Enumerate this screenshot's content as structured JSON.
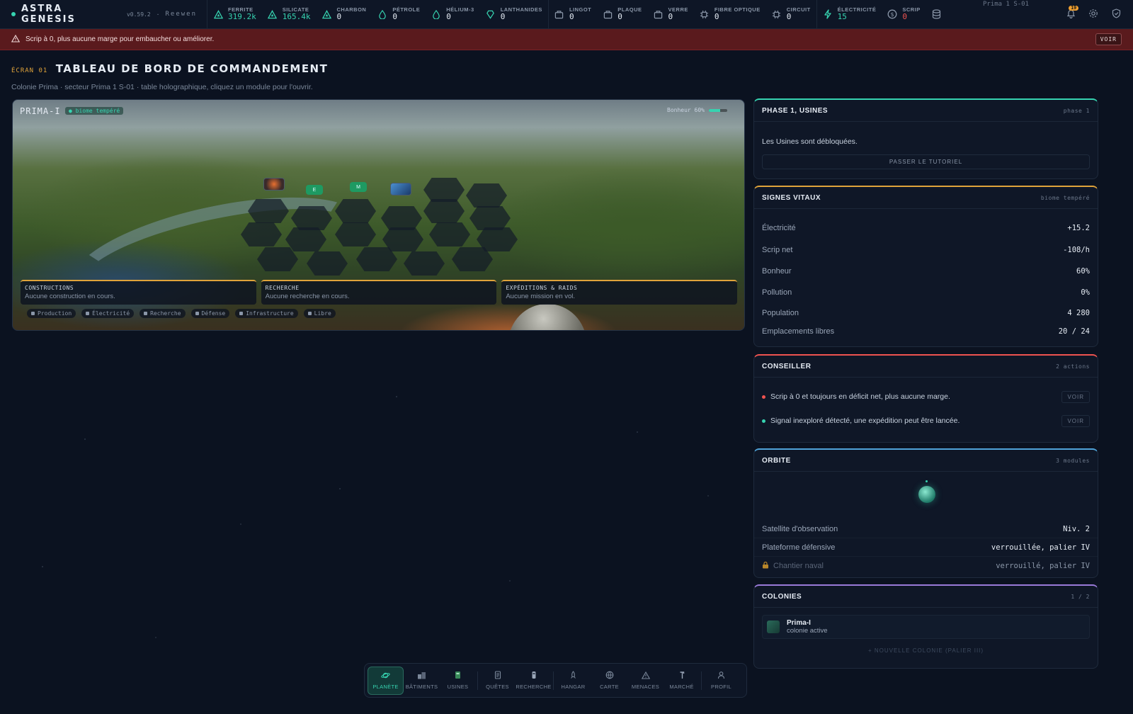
{
  "brand": {
    "name": "ASTRA GENESIS",
    "version": "v0.59.2",
    "separator": "·",
    "user": "Reewen"
  },
  "resources": [
    {
      "label": "FERRITE",
      "value": "319.2k",
      "tone": "green",
      "icon": "triangle-icon"
    },
    {
      "label": "SILICATE",
      "value": "165.4k",
      "tone": "green",
      "icon": "triangle-icon"
    },
    {
      "label": "CHARBON",
      "value": "0",
      "tone": "",
      "icon": "triangle-icon"
    },
    {
      "label": "PÉTROLE",
      "value": "0",
      "tone": "",
      "icon": "drop-icon"
    },
    {
      "label": "HÉLIUM-3",
      "value": "0",
      "tone": "",
      "icon": "drop-icon"
    },
    {
      "label": "LANTHANIDES",
      "value": "0",
      "tone": "",
      "icon": "gem-icon"
    },
    {
      "label": "LINGOT",
      "value": "0",
      "tone": "",
      "icon": "box-icon"
    },
    {
      "label": "PLAQUE",
      "value": "0",
      "tone": "",
      "icon": "box-icon"
    },
    {
      "label": "VERRE",
      "value": "0",
      "tone": "",
      "icon": "box-icon"
    },
    {
      "label": "FIBRE OPTIQUE",
      "value": "0",
      "tone": "",
      "icon": "chip-icon"
    },
    {
      "label": "CIRCUIT",
      "value": "0",
      "tone": "",
      "icon": "chip-icon"
    },
    {
      "label": "ÉLECTRICITÉ",
      "value": "15",
      "tone": "green",
      "icon": "bolt-icon"
    },
    {
      "label": "SCRIP",
      "value": "0",
      "tone": "red",
      "icon": "coin-icon"
    }
  ],
  "top_right": {
    "sector": "Prima 1 S-01",
    "notif_count": "19"
  },
  "alert": {
    "text": "Scrip à 0, plus aucune marge pour embaucher ou améliorer.",
    "button": "VOIR"
  },
  "header": {
    "screen_num": "ÉCRAN 01",
    "title": "TABLEAU DE BORD DE COMMANDEMENT",
    "subtitle": "Colonie Prima · secteur Prima 1 S-01 · table holographique, cliquez un module pour l'ouvrir."
  },
  "planet": {
    "name": "PRIMA-I",
    "biome": "● biome tempéré",
    "happiness_label": "Bonheur 60%",
    "happiness_fraction": 0.6,
    "cards": [
      {
        "title": "CONSTRUCTIONS",
        "text": "Aucune construction en cours."
      },
      {
        "title": "RECHERCHE",
        "text": "Aucune recherche en cours."
      },
      {
        "title": "EXPÉDITIONS & RAIDS",
        "text": "Aucune mission en vol."
      }
    ],
    "legend": [
      "Production",
      "Électricité",
      "Recherche",
      "Défense",
      "Infrastructure",
      "Libre"
    ],
    "module_e": "E",
    "module_m": "M"
  },
  "phase": {
    "title": "PHASE 1, USINES",
    "tag": "phase 1",
    "text": "Les Usines sont débloquées.",
    "button": "PASSER LE TUTORIEL"
  },
  "vitals": {
    "title": "SIGNES VITAUX",
    "tag": "biome tempéré",
    "rows": [
      {
        "label": "Électricité",
        "value": "+15.2"
      },
      {
        "label": "Scrip net",
        "value": "-108/h"
      },
      {
        "label": "Bonheur",
        "value": "60%"
      },
      {
        "label": "Pollution",
        "value": "0%"
      },
      {
        "label": "Population",
        "value": "4 280"
      },
      {
        "label": "Emplacements libres",
        "value": "20 / 24"
      }
    ]
  },
  "advisor": {
    "title": "CONSEILLER",
    "tag": "2 actions",
    "items": [
      {
        "text": "Scrip à 0 et toujours en déficit net, plus aucune marge.",
        "button": "VOIR",
        "color": "#ef5350"
      },
      {
        "text": "Signal inexploré détecté, une expédition peut être lancée.",
        "button": "VOIR",
        "color": "#36d3b0"
      }
    ]
  },
  "orbit": {
    "title": "ORBITE",
    "tag": "3 modules",
    "rows": [
      {
        "label": "Satellite d'observation",
        "value": "Niv. 2"
      },
      {
        "label": "Plateforme défensive",
        "value": "verrouillée, palier IV"
      },
      {
        "label": "Chantier naval",
        "value": "verrouillé, palier IV"
      }
    ]
  },
  "colonies": {
    "title": "COLONIES",
    "tag": "1 / 2",
    "item_name": "Prima-I",
    "item_state": "colonie active",
    "new": "+ NOUVELLE COLONIE (PALIER III)"
  },
  "nav": [
    {
      "label": "PLANÈTE",
      "icon": "planet-icon"
    },
    {
      "label": "BÂTIMENTS",
      "icon": "buildings-icon"
    },
    {
      "label": "USINES",
      "icon": "factory-icon"
    },
    {
      "label": "QUÊTES",
      "icon": "scroll-icon"
    },
    {
      "label": "RECHERCHE",
      "icon": "flask-icon"
    },
    {
      "label": "HANGAR",
      "icon": "rocket-icon"
    },
    {
      "label": "CARTE",
      "icon": "globe-icon"
    },
    {
      "label": "MENACES",
      "icon": "warning-icon"
    },
    {
      "label": "MARCHÉ",
      "icon": "market-icon"
    },
    {
      "label": "PROFIL",
      "icon": "user-icon"
    }
  ],
  "colors": {
    "accent": "#36d3b0",
    "warning": "#e0a33a",
    "danger": "#ef5350",
    "alert_bg": "#5a1a1d"
  }
}
